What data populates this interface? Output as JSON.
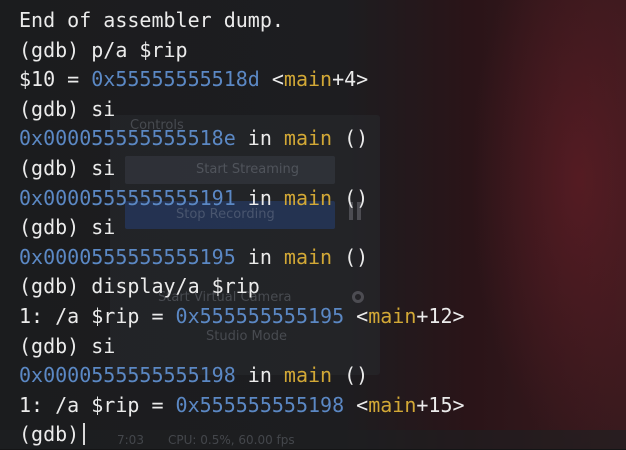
{
  "background_app": {
    "panel_title": "Controls",
    "start_streaming": "Start Streaming",
    "stop_recording": "Stop Recording",
    "virtual_camera": "Start Virtual Camera",
    "studio_mode": "Studio Mode",
    "status_time": "7:03",
    "status_cpu": "CPU: 0.5%, 60.00 fps"
  },
  "terminal": {
    "header": "End of assembler dump.",
    "prompt": "(gdb)",
    "cmd1": "p/a $rip",
    "l1_prefix": "$10 = ",
    "l1_addr": "0x55555555518d",
    "l1_open": " <",
    "l1_fn": "main",
    "l1_close": "+4>",
    "cmd_si": "si",
    "s1_addr": "0x000055555555518e",
    "s2_addr": "0x0000555555555191",
    "s3_addr": "0x0000555555555195",
    "s4_addr": "0x0000555555555198",
    "in_text": " in ",
    "fn_name": "main",
    "parens": " ()",
    "cmd_display": "display/a $rip",
    "disp_prefix": "1: /a $rip = ",
    "d1_addr": "0x555555555195",
    "d1_offset": "+12>",
    "d2_addr": "0x555555555198",
    "d2_offset": "+15>",
    "open_angle": " <"
  },
  "colors": {
    "text": "#ebebeb",
    "address": "#5b88c4",
    "function": "#d2a836",
    "background": "#141516"
  }
}
